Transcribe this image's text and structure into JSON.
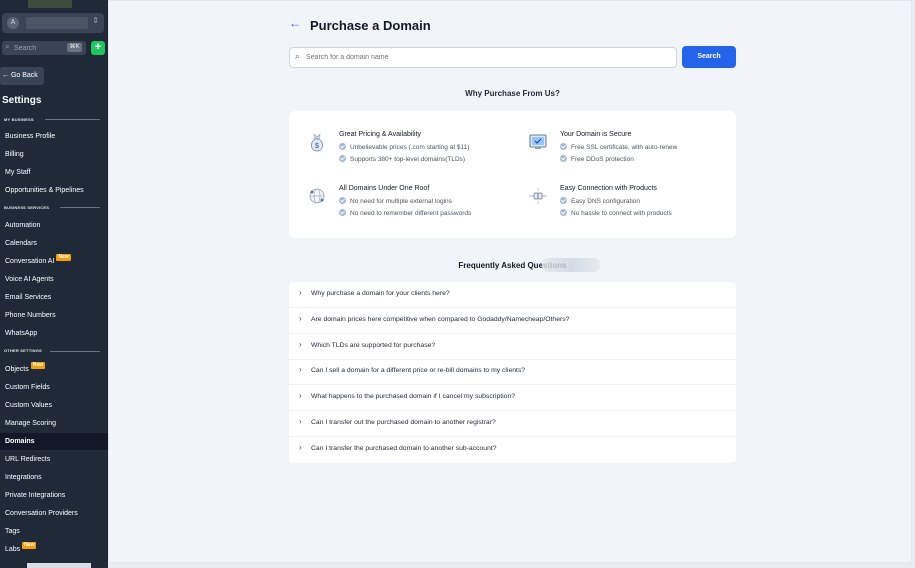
{
  "sidebar": {
    "account_icon": "A",
    "search_placeholder": "Search",
    "search_shortcut": "⌘K",
    "add_icon": "+",
    "go_back": "← Go Back",
    "title": "Settings",
    "sections": {
      "my_business": "MY BUSINESS",
      "business_services": "BUSINESS SERVICES",
      "other_settings": "OTHER SETTINGS"
    },
    "items": [
      {
        "label": "Business Profile",
        "badge": ""
      },
      {
        "label": "Billing",
        "badge": ""
      },
      {
        "label": "My Staff",
        "badge": ""
      },
      {
        "label": "Opportunities & Pipelines",
        "badge": ""
      },
      {
        "label": "Automation",
        "badge": ""
      },
      {
        "label": "Calendars",
        "badge": ""
      },
      {
        "label": "Conversation AI",
        "badge": "New"
      },
      {
        "label": "Voice AI Agents",
        "badge": ""
      },
      {
        "label": "Email Services",
        "badge": ""
      },
      {
        "label": "Phone Numbers",
        "badge": ""
      },
      {
        "label": "WhatsApp",
        "badge": ""
      },
      {
        "label": "Objects",
        "badge": "New"
      },
      {
        "label": "Custom Fields",
        "badge": ""
      },
      {
        "label": "Custom Values",
        "badge": ""
      },
      {
        "label": "Manage Scoring",
        "badge": ""
      },
      {
        "label": "Domains",
        "badge": "",
        "active": true
      },
      {
        "label": "URL Redirects",
        "badge": ""
      },
      {
        "label": "Integrations",
        "badge": ""
      },
      {
        "label": "Private Integrations",
        "badge": ""
      },
      {
        "label": "Conversation Providers",
        "badge": ""
      },
      {
        "label": "Tags",
        "badge": ""
      },
      {
        "label": "Labs",
        "badge": "New"
      }
    ]
  },
  "main": {
    "back_icon": "←",
    "title": "Purchase a Domain",
    "search": {
      "placeholder": "Search for a domain name",
      "button": "Search"
    },
    "why_title": "Why Purchase From Us?",
    "features": [
      {
        "title": "Great Pricing & Availability",
        "icon": "money-bag-icon",
        "points": [
          "Unbelievable prices (.com starting at $11)",
          "Supports 380+ top-level domains(TLDs)"
        ]
      },
      {
        "title": "Your Domain is Secure",
        "icon": "secure-monitor-icon",
        "points": [
          "Free SSL certificate, with auto-renew",
          "Free DDoS protection"
        ]
      },
      {
        "title": "All Domains Under One Roof",
        "icon": "globe-icon",
        "points": [
          "No need for multiple external logins",
          "No need to remember different passwords"
        ]
      },
      {
        "title": "Easy Connection with Products",
        "icon": "plug-connection-icon",
        "points": [
          "Easy DNS configuration",
          "No hassle to connect with products"
        ]
      }
    ],
    "faq_title": "Frequently Asked Questions",
    "faqs": [
      "Why purchase a domain for your clients here?",
      "Are domain prices here competitive when compared to Godaddy/Namecheap/Others?",
      "Which TLDs are supported for purchase?",
      "Can I sell a domain for a different price or re-bill domains to my clients?",
      "What happens to the purchased domain if I cancel my subscription?",
      "Can I transfer out the purchased domain to another registrar?",
      "Can I transfer the purchased domain to another sub-account?"
    ]
  },
  "colors": {
    "sidebar_bg": "#1f2937",
    "accent": "#2563eb",
    "badge": "#f59e0b",
    "add_button": "#22c55e"
  }
}
